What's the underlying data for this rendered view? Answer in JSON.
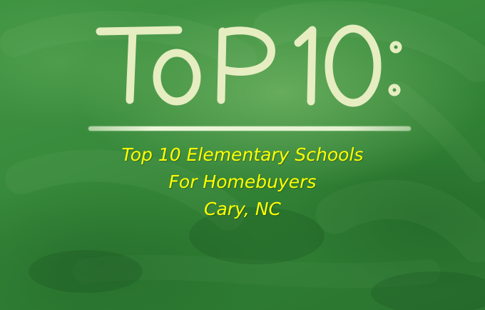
{
  "headline": {
    "text": "ToP 10:",
    "chalk_color": "#eef2c8"
  },
  "caption": {
    "lines": [
      "Top 10 Elementary Schools",
      "For Homebuyers",
      "Cary, NC"
    ],
    "color": "#ffff00"
  },
  "background": {
    "chalkboard_color": "#3a8c3d"
  }
}
